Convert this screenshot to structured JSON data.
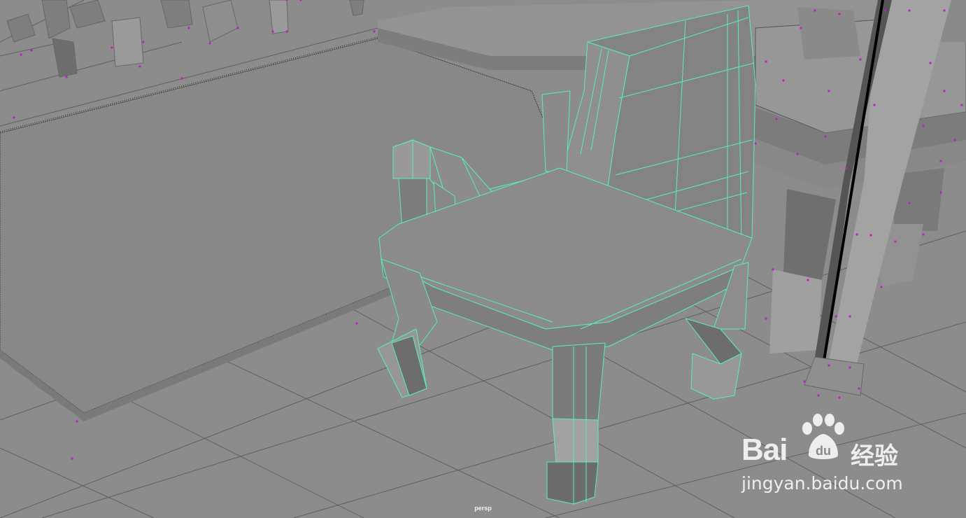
{
  "viewport": {
    "camera_label": "persp",
    "colors": {
      "background": "#8a8a8a",
      "selection_wireframe": "#57f2b0",
      "vertex_points": "#c41cc4",
      "grid": "#5a5a5a"
    }
  },
  "watermark": {
    "brand": "Bai",
    "brand_suffix": "经验",
    "paw_text": "du",
    "url": "jingyan.baidu.com"
  }
}
